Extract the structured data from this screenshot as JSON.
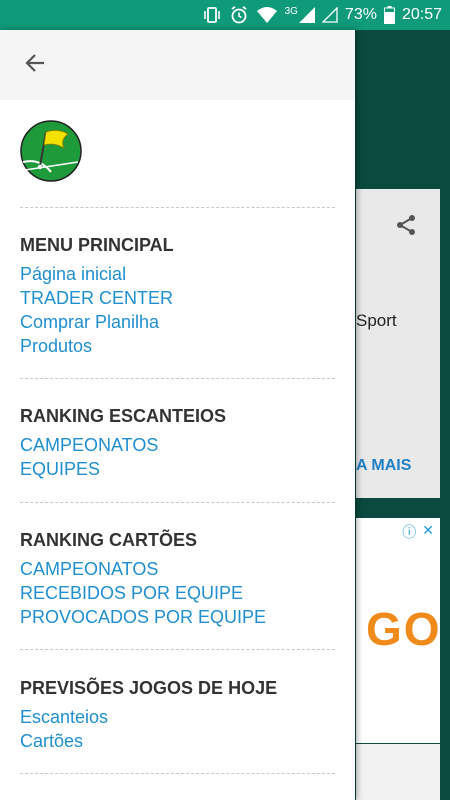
{
  "status_bar": {
    "network": "3G",
    "battery": "73%",
    "time": "20:57",
    "icons": [
      "vibrate-icon",
      "alarm-icon",
      "wifi-icon",
      "signal-icon",
      "signal-empty-icon",
      "battery-icon"
    ]
  },
  "background": {
    "card_text": "Sport",
    "card_link": "A MAIS",
    "ad_text": "GO",
    "ad_icons": [
      "info-icon",
      "close-icon"
    ]
  },
  "drawer": {
    "back_icon": "arrow-back-icon",
    "logo_icon": "corner-flag-logo",
    "sections": [
      {
        "title": "MENU PRINCIPAL",
        "items": [
          "Página inicial",
          "TRADER CENTER",
          "Comprar Planilha",
          "Produtos"
        ]
      },
      {
        "title": "RANKING ESCANTEIOS",
        "items": [
          "CAMPEONATOS",
          "EQUIPES"
        ]
      },
      {
        "title": "RANKING CARTÕES",
        "items": [
          "CAMPEONATOS",
          "RECEBIDOS POR EQUIPE",
          "PROVOCADOS POR EQUIPE"
        ]
      },
      {
        "title": "PREVISÕES JOGOS DE HOJE",
        "items": [
          "Escanteios",
          "Cartões"
        ]
      }
    ]
  },
  "colors": {
    "status_bar": "#0f9a7a",
    "app_background": "#0b4a3f",
    "link": "#1f8fd0",
    "section_title": "#333333"
  }
}
